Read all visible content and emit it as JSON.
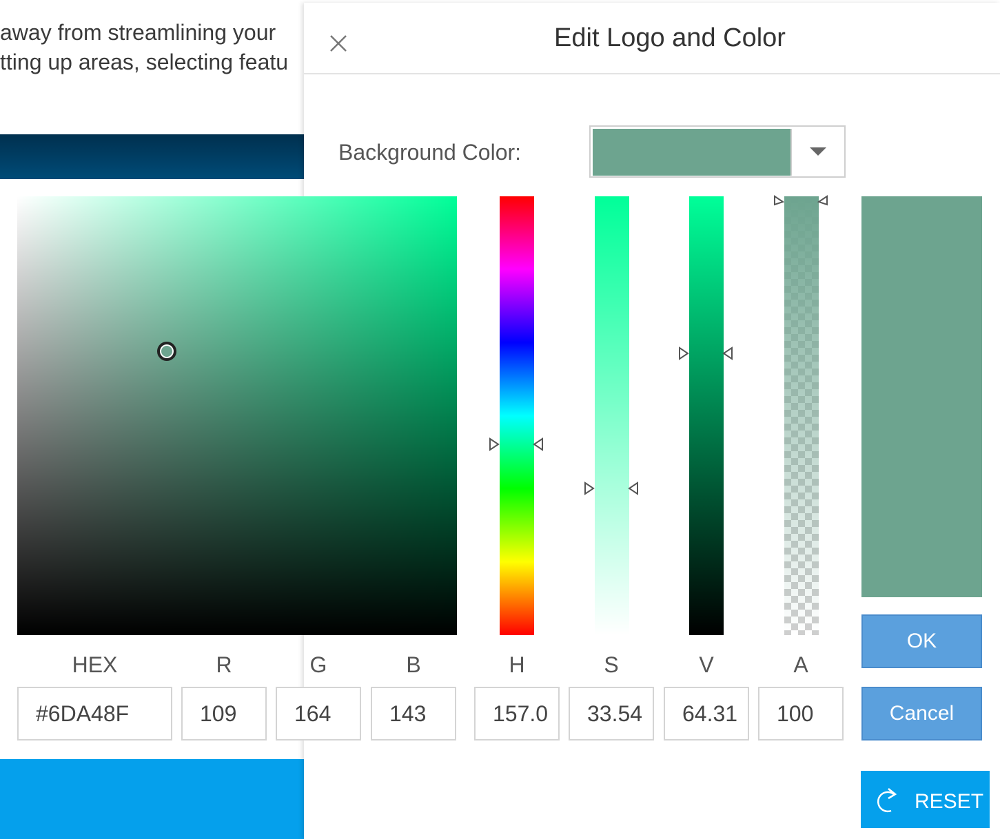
{
  "background": {
    "text_line1": "away from streamlining your",
    "text_line2": "tting up areas, selecting featu"
  },
  "dialog": {
    "title": "Edit Logo and Color",
    "close_icon": "close-icon",
    "background_color_label": "Background Color:",
    "background_color_value": "#6DA48F",
    "dropdown_icon": "chevron-down-icon"
  },
  "picker": {
    "hue_color": "#00ff99",
    "current_color": "#6DA48F",
    "hue_level": 0.564,
    "saturation_level": 0.335,
    "value_level": 0.643,
    "alpha_level": 1.0
  },
  "fields": {
    "hex": {
      "label": "HEX",
      "value": "#6DA48F"
    },
    "r": {
      "label": "R",
      "value": "109"
    },
    "g": {
      "label": "G",
      "value": "164"
    },
    "b": {
      "label": "B",
      "value": "143"
    },
    "h": {
      "label": "H",
      "value": "157.0"
    },
    "s": {
      "label": "S",
      "value": "33.54"
    },
    "v": {
      "label": "V",
      "value": "64.31"
    },
    "a": {
      "label": "A",
      "value": "100"
    }
  },
  "buttons": {
    "ok": "OK",
    "cancel": "Cancel",
    "reset": "RESET",
    "reset_icon": "rotate-right-icon"
  },
  "colors": {
    "accent_button": "#5ba0dd",
    "reset_button": "#05a0ec",
    "header_band": "#004b77"
  }
}
